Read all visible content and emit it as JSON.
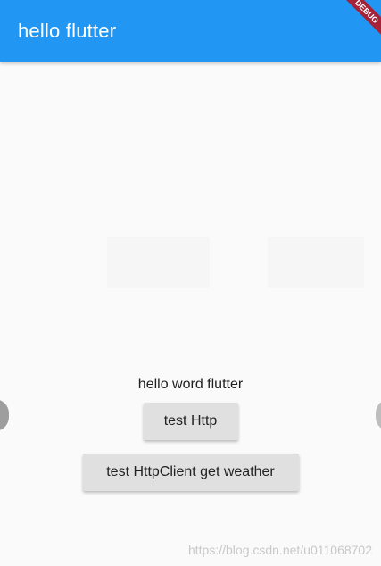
{
  "app": {
    "title": "hello flutter",
    "debug_banner": "DEBUG",
    "accent_color": "#2196f3"
  },
  "main": {
    "hello_text": "hello word flutter",
    "buttons": {
      "test_http": "test Http",
      "test_httpclient_weather": "test HttpClient get weather"
    }
  },
  "watermark": "https://blog.csdn.net/u011068702"
}
